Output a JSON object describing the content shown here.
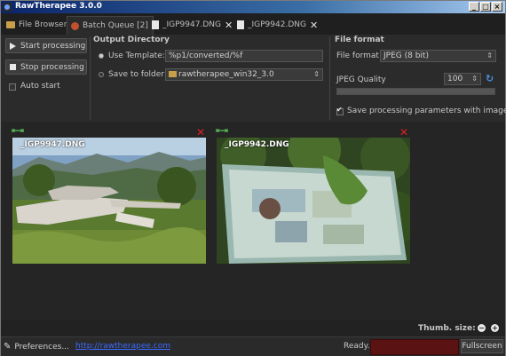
{
  "window": {
    "title": "RawTherapee 3.0.0",
    "min": "_",
    "max": "□",
    "close": "×"
  },
  "tabs": [
    {
      "label": "File Browser"
    },
    {
      "label": "Batch Queue [2]"
    },
    {
      "label": "_IGP9947.DNG"
    },
    {
      "label": "_IGP9942.DNG"
    }
  ],
  "queue_controls": {
    "start": "Start processing",
    "stop": "Stop processing",
    "auto_start": "Auto start"
  },
  "output_directory": {
    "heading": "Output Directory",
    "use_template_label": "Use Template:",
    "template_value": "%p1/converted/%f",
    "save_to_folder_label": "Save to folder:",
    "folder_value": "rawtherapee_win32_3.0",
    "selected": "use_template"
  },
  "file_format": {
    "heading": "File format",
    "format_label": "File format:",
    "format_value": "JPEG (8 bit)",
    "quality_label": "JPEG Quality",
    "quality_value": "100",
    "quality_fraction": 1.0,
    "save_params_label": "Save processing parameters with image",
    "save_params_checked": true
  },
  "queue_items": [
    {
      "filename": "_IGP9947.DNG",
      "nav_icons": "⇤⇥",
      "remove_icon": "✕"
    },
    {
      "filename": "_IGP9942.DNG",
      "nav_icons": "⇤⇥",
      "remove_icon": "✕"
    }
  ],
  "thumb_size": {
    "label": "Thumb. size:",
    "minus": "−",
    "plus": "+"
  },
  "statusbar": {
    "preferences": "Preferences...",
    "link": "http://rawtherapee.com",
    "status": "Ready.",
    "fullscreen": "Fullscreen"
  },
  "icons": {
    "wrench": "wrench-icon",
    "folder": "folder-icon",
    "refresh": "refresh-icon"
  },
  "colors": {
    "progress": "#5a1212",
    "remove": "#e02020",
    "link": "#3c6cff",
    "nav": "#5ed05e"
  }
}
